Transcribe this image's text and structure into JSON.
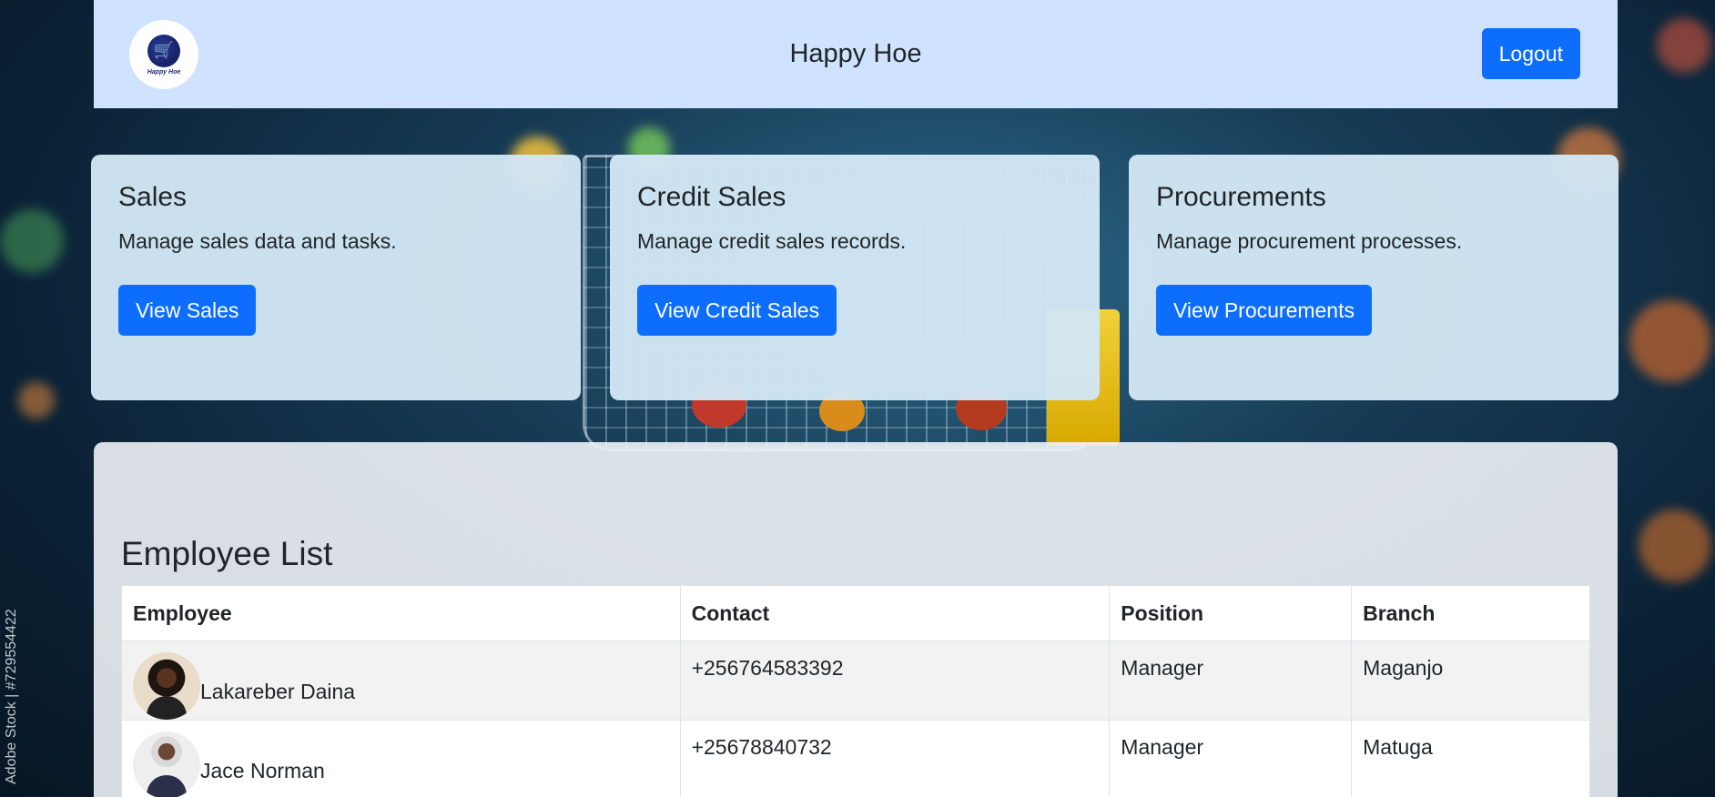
{
  "header": {
    "logo_text": "Happy Hoe",
    "title": "Happy Hoe",
    "logout_label": "Logout"
  },
  "cards": [
    {
      "title": "Sales",
      "description": "Manage sales data and tasks.",
      "button_label": "View Sales"
    },
    {
      "title": "Credit Sales",
      "description": "Manage credit sales records.",
      "button_label": "View Credit Sales"
    },
    {
      "title": "Procurements",
      "description": "Manage procurement processes.",
      "button_label": "View Procurements"
    }
  ],
  "employees": {
    "heading": "Employee List",
    "columns": [
      "Employee",
      "Contact",
      "Position",
      "Branch"
    ],
    "rows": [
      {
        "name": "Lakareber Daina",
        "contact": "+256764583392",
        "position": "Manager",
        "branch": "Maganjo"
      },
      {
        "name": "Jace Norman",
        "contact": "+25678840732",
        "position": "Manager",
        "branch": "Matuga"
      }
    ]
  },
  "watermark": "Adobe Stock | #729554422",
  "colors": {
    "header_bg": "#cfe2ff",
    "primary_button": "#0d6efd",
    "card_bg": "#d2e6f4"
  }
}
